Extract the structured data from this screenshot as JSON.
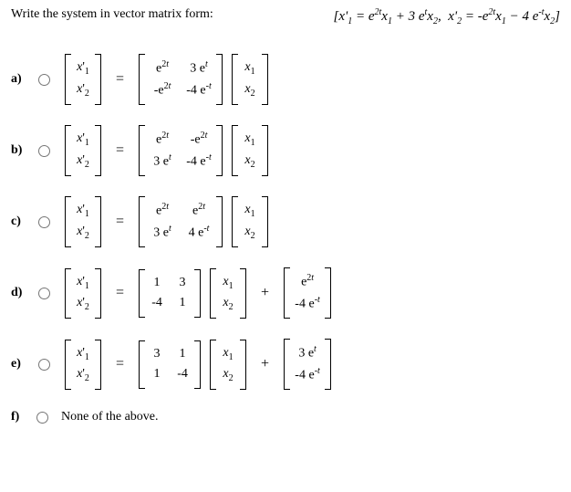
{
  "prompt": "Write the system in vector matrix form:",
  "given": {
    "open": "[",
    "eq1_lhs": "x'₁",
    "eq1_rhs_t1": "= e²ᵗx₁",
    "eq1_rhs_t2": " + 3 eᵗx₂,",
    "eq2_lhs": "   x'₂",
    "eq2_rhs_t1": "= -e²ᵗx₁",
    "eq2_rhs_t2": " − 4 e⁻ᵗx₂",
    "close": "]"
  },
  "xprime": {
    "r1": "x'₁",
    "r2": "x'₂"
  },
  "xvec": {
    "r1": "x₁",
    "r2": "x₂"
  },
  "options": {
    "a": {
      "label": "a)",
      "m": [
        [
          "e²ᵗ",
          "3 eᵗ"
        ],
        [
          "-e²ᵗ",
          "-4 e⁻ᵗ"
        ]
      ]
    },
    "b": {
      "label": "b)",
      "m": [
        [
          "e²ᵗ",
          "-e²ᵗ"
        ],
        [
          "3 eᵗ",
          "-4 e⁻ᵗ"
        ]
      ]
    },
    "c": {
      "label": "c)",
      "m": [
        [
          "e²ᵗ",
          "e²ᵗ"
        ],
        [
          "3 eᵗ",
          "4 e⁻ᵗ"
        ]
      ]
    },
    "d": {
      "label": "d)",
      "m": [
        [
          "1",
          "3"
        ],
        [
          "-4",
          "1"
        ]
      ],
      "v": [
        "e²ᵗ",
        "-4 e⁻ᵗ"
      ]
    },
    "e": {
      "label": "e)",
      "m": [
        [
          "3",
          "1"
        ],
        [
          "1",
          "-4"
        ]
      ],
      "v": [
        "3 eᵗ",
        "-4 e⁻ᵗ"
      ]
    },
    "f": {
      "label": "f)",
      "text": "None of the above."
    }
  },
  "eq_sign": "=",
  "plus_sign": "+"
}
